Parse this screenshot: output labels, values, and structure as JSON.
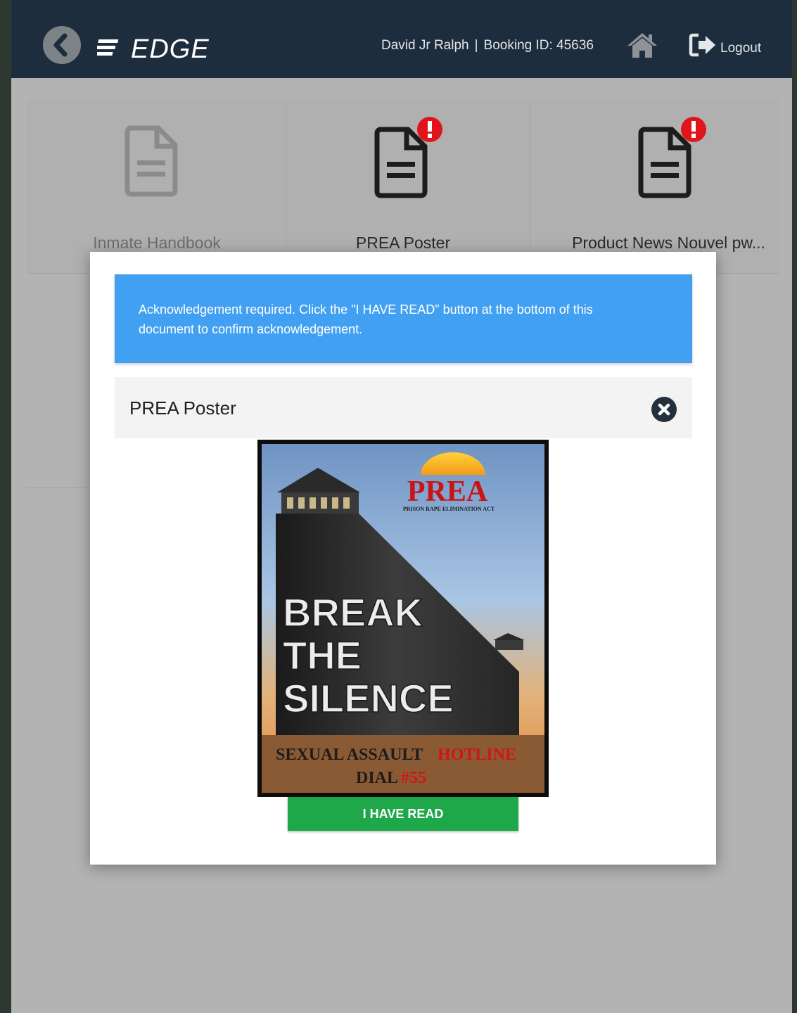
{
  "header": {
    "logo_text": "EDGE",
    "user_name": "David Jr Ralph",
    "separator": "|",
    "booking_label": "Booking ID: 45636",
    "logout_label": "Logout"
  },
  "tiles": [
    {
      "label": "Inmate Handbook",
      "alert": false
    },
    {
      "label": "PREA Poster",
      "alert": true
    },
    {
      "label": "Product News Nouvel pw..."
    }
  ],
  "modal": {
    "ack_text": "Acknowledgement required. Click the \"I HAVE READ\" button at the bottom of this document to confirm acknowledgement.",
    "doc_title": "PREA Poster",
    "read_button": "I HAVE READ"
  },
  "poster": {
    "title": "PREA",
    "subtitle": "PRISON RAPE ELIMINATION ACT",
    "headline": [
      "BREAK",
      "THE",
      "SILENCE"
    ],
    "footer_line1": "SEXUAL ASSAULT",
    "footer_line1_red": "HOTLINE",
    "footer_line2": "DIAL",
    "footer_line2_red": "#55"
  },
  "colors": {
    "header_bg": "#1e2d3d",
    "banner_bg": "#42a0f2",
    "read_button_bg": "#1fa84a",
    "alert_red": "#e0141a"
  }
}
